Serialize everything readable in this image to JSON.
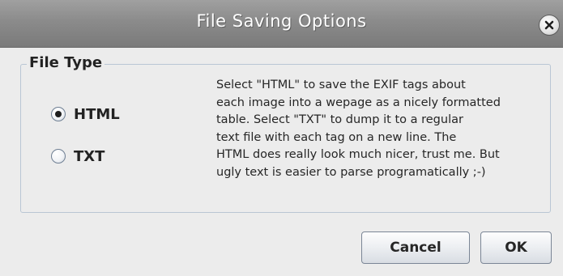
{
  "window": {
    "title": "File Saving Options",
    "close_icon": "close-icon"
  },
  "file_type": {
    "group_title": "File Type",
    "options": [
      {
        "label": "HTML",
        "selected": true
      },
      {
        "label": "TXT",
        "selected": false
      }
    ],
    "description_lines": [
      "Select \"HTML\" to save the EXIF tags about",
      "each image into a wepage as a nicely formatted",
      "table.  Select \"TXT\" to dump it to a regular",
      "text file with each tag on a new line.  The",
      "HTML does really look much nicer, trust me. But",
      "ugly text is easier to parse programatically ;-)"
    ]
  },
  "buttons": {
    "cancel_label": "Cancel",
    "ok_label": "OK"
  },
  "colors": {
    "titlebar": "#8b8b8b",
    "dialog_background": "#ececec",
    "group_border": "#b9c6d4"
  }
}
